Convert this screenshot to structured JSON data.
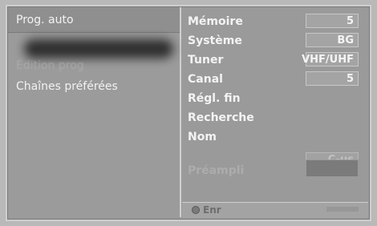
{
  "left_menu": {
    "selected": "Prog. auto",
    "blurred": "Édition prog",
    "item": "Chaînes préférées"
  },
  "right_menu": {
    "rows": [
      {
        "label": "Mémoire",
        "value": "5"
      },
      {
        "label": "Système",
        "value": "BG"
      },
      {
        "label": "Tuner",
        "value": "VHF/UHF"
      },
      {
        "label": "Canal",
        "value": "5"
      },
      {
        "label": "Régl. fin",
        "value": ""
      },
      {
        "label": "Recherche",
        "value": ""
      },
      {
        "label": "Nom",
        "value": ""
      }
    ],
    "cus": "C-us",
    "prefill_label": "Préampli"
  },
  "footer": {
    "enter_label": "Enr"
  }
}
